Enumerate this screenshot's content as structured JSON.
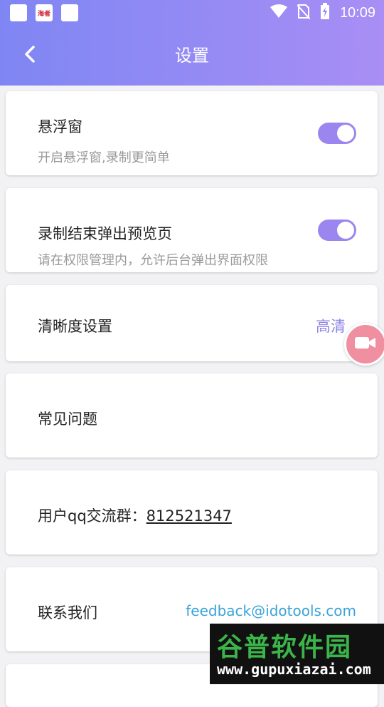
{
  "status_bar": {
    "time": "10:09",
    "left_icons": [
      "app-icon-1",
      "app-icon-2",
      "app-icon-3"
    ],
    "left_icon_text": "海者"
  },
  "header": {
    "title": "设置",
    "back_icon": "chevron-left-icon"
  },
  "settings": {
    "floating_window": {
      "title": "悬浮窗",
      "subtitle": "开启悬浮窗,录制更简单",
      "enabled": true
    },
    "preview_popup": {
      "title": "录制结束弹出预览页",
      "subtitle": "请在权限管理内，允许后台弹出界面权限",
      "enabled": true
    },
    "quality": {
      "title": "清晰度设置",
      "value": "高清"
    },
    "faq": {
      "title": "常见问题"
    },
    "qq_group": {
      "label": "用户qq交流群：",
      "number": "812521347"
    },
    "contact": {
      "title": "联系我们",
      "email": "feedback@idotools.com"
    }
  },
  "floating_button": {
    "icon": "video-camera-icon"
  },
  "watermark": {
    "brand": "谷普软件园",
    "url": "www.gupuxiazai.com"
  },
  "colors": {
    "header_gradient_start": "#7f86f3",
    "header_gradient_end": "#a88ef5",
    "toggle_on": "#9b86f0",
    "value_text": "#8e86e6",
    "link": "#3aa3d7"
  }
}
